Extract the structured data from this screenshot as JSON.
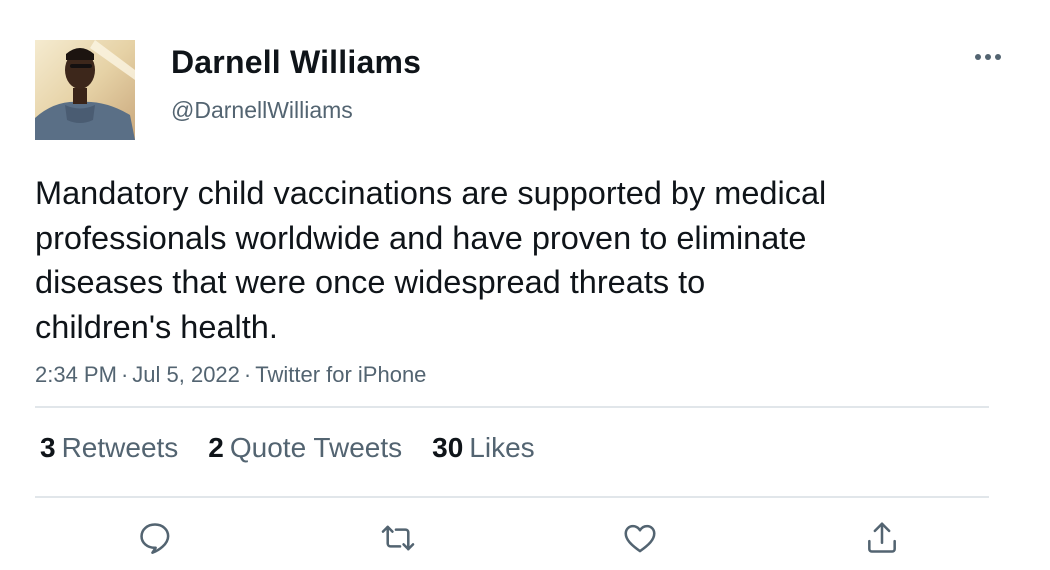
{
  "user": {
    "display_name": "Darnell Williams",
    "handle": "@DarnellWilliams"
  },
  "tweet": {
    "text": "Mandatory child vaccinations are supported by medical\nprofessionals worldwide and have proven to eliminate\ndiseases that were once widespread threats to\nchildren's health.",
    "time": "2:34 PM",
    "date": "Jul 5, 2022",
    "source": "Twitter for iPhone",
    "separator": "·"
  },
  "stats": {
    "retweets_count": "3",
    "retweets_label": "Retweets",
    "quotes_count": "2",
    "quotes_label": "Quote Tweets",
    "likes_count": "30",
    "likes_label": "Likes"
  },
  "actions": [
    {
      "icon": "reply-icon"
    },
    {
      "icon": "retweet-icon"
    },
    {
      "icon": "like-icon"
    },
    {
      "icon": "share-icon"
    }
  ],
  "colors": {
    "text": "#0f1419",
    "secondary": "#536471",
    "divider": "#e1e6ea",
    "icon": "#536471"
  }
}
